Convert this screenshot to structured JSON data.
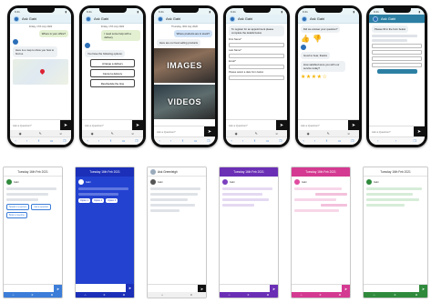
{
  "phones": [
    {
      "status_time": "9:41",
      "header_title": "Ask Gabi",
      "date": "Friday, 17th July 2020",
      "user_message": "Where is your office?",
      "bot_message": "Here is a map to show you how to find us",
      "ask_placeholder": "Ask a Question?"
    },
    {
      "status_time": "9:41",
      "header_title": "Ask Gabi",
      "date": "Friday, 17th July 2020",
      "user_message": "I need some help with a delivery",
      "bot_message": "You have the following options:",
      "options": [
        "Arrange a delivery",
        "Cancel a delivery",
        "Reschedule the time"
      ],
      "ask_placeholder": "Ask a Question?"
    },
    {
      "status_time": "9:41",
      "header_title": "Ask Gabi",
      "date": "Thursday, 30th July 2020",
      "user_message": "Where products are in stock?",
      "bot_message": "Here are our best selling products",
      "image_caption": "IMAGES",
      "video_caption": "VIDEOS",
      "ask_placeholder": "Ask a Question?"
    },
    {
      "status_time": "9:41",
      "header_title": "Ask Gabi",
      "bot_message": "To register for an appointment please complete the details below",
      "fields": [
        "First Name*",
        "Last Name*",
        "Email*",
        "Please select a date from below"
      ],
      "ask_placeholder": "Ask a Question?"
    },
    {
      "status_time": "9:41",
      "header_title": "Ask Gabi",
      "bot_message": "Did we answer your question?",
      "bot_message_2": "Good to hear, thanks",
      "rating_question": "How satisfied were you with our service today?",
      "ask_placeholder": "Ask a Question?"
    },
    {
      "status_time": "9:41",
      "header_title": "Ask Gabi",
      "bot_message": "Please fill in the form below",
      "ask_placeholder": "Ask a Question?"
    }
  ],
  "cards": [
    {
      "title": "Tuesday 16th Feb 2021",
      "bot_name": "Gabi",
      "accent": "#3b7dd8",
      "head_bg": "#ffffff",
      "buttons": [
        "Speak to a person",
        "Ask a question",
        "Book a meeting"
      ]
    },
    {
      "title": "Tuesday 16th Feb 2021",
      "bot_name": "Gabi",
      "accent": "#2747c9",
      "head_bg": "#1b2fb8",
      "buttons": [
        "Option 1",
        "Option 2",
        "Option 3"
      ]
    },
    {
      "title": "Ask Greenleigh",
      "bot_name": "Gabi",
      "accent": "#111111",
      "head_bg": "#ffffff",
      "buttons": []
    },
    {
      "title": "Tuesday 16th Feb 2021",
      "bot_name": "Gabi",
      "accent": "#7b3fbf",
      "head_bg": "#6a2fb5",
      "buttons": []
    },
    {
      "title": "Tuesday 16th Feb 2021",
      "bot_name": "Gabi",
      "accent": "#e04ba0",
      "head_bg": "#d43a91",
      "buttons": []
    },
    {
      "title": "Tuesday 16th Feb 2021",
      "bot_name": "Gabi",
      "accent": "#2f8a3c",
      "head_bg": "#ffffff",
      "buttons": []
    }
  ],
  "colors": {
    "bot_bubble": "#eef1f4",
    "user_bubble": "#e3f0d2",
    "header_bg": "#e4f1f6",
    "send_button": "#111111"
  }
}
